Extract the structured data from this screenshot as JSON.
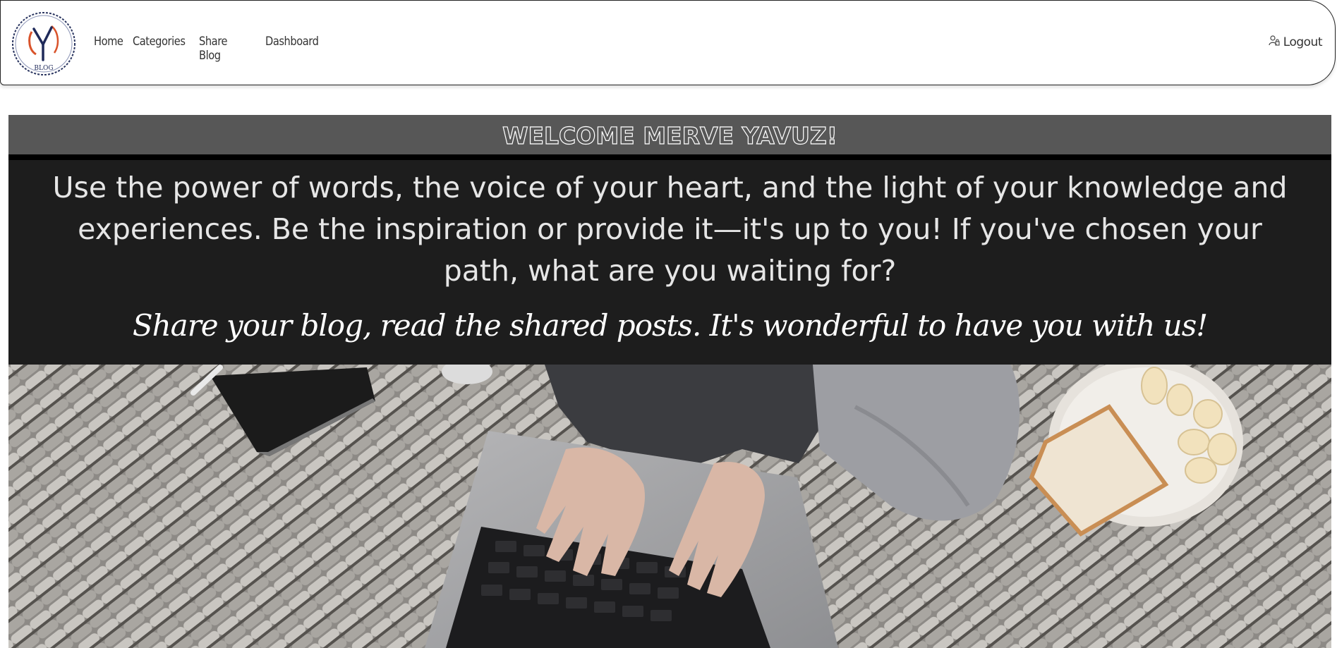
{
  "nav": {
    "logo_text": "BLOG",
    "links": [
      "Home",
      "Categories",
      "Share Blog",
      "Dashboard"
    ],
    "logout_label": "Logout"
  },
  "hero": {
    "welcome": "WELCOME MERVE YAVUZ!",
    "intro": "Use the power of words, the voice of your heart, and the light of your knowledge and experiences. Be the inspiration or provide it—it's up to you! If you've chosen your path, what are you waiting for?",
    "tagline": "Share your blog, read the shared posts.  It's wonderful to have you with us!"
  },
  "colors": {
    "welcome_bar": "#575757",
    "panel": "#1d1d1d",
    "accent_logo": "#d9532b",
    "logo_navy": "#1f2a5a"
  }
}
